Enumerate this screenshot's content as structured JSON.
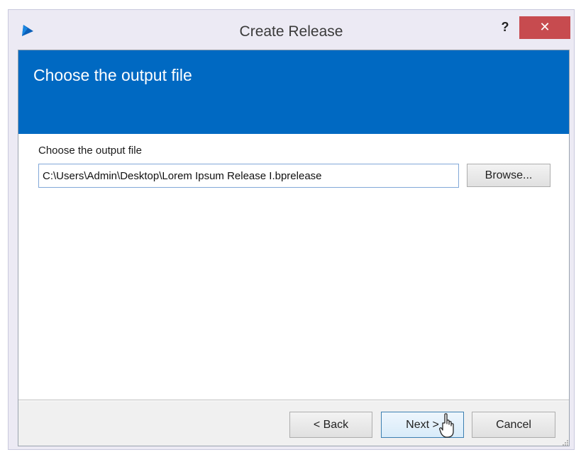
{
  "window": {
    "title": "Create Release",
    "help_label": "?",
    "close_label": "✕",
    "app_icon": "app-logo-icon"
  },
  "banner": {
    "title": "Choose the output file",
    "color": "#0069c2"
  },
  "form": {
    "label": "Choose the output file",
    "path_value": "C:\\Users\\Admin\\Desktop\\Lorem Ipsum Release I.bprelease",
    "browse_label": "Browse..."
  },
  "footer": {
    "back_label": "< Back",
    "next_label": "Next >",
    "cancel_label": "Cancel"
  },
  "colors": {
    "accent": "#0069c2",
    "close": "#c74b4f"
  }
}
